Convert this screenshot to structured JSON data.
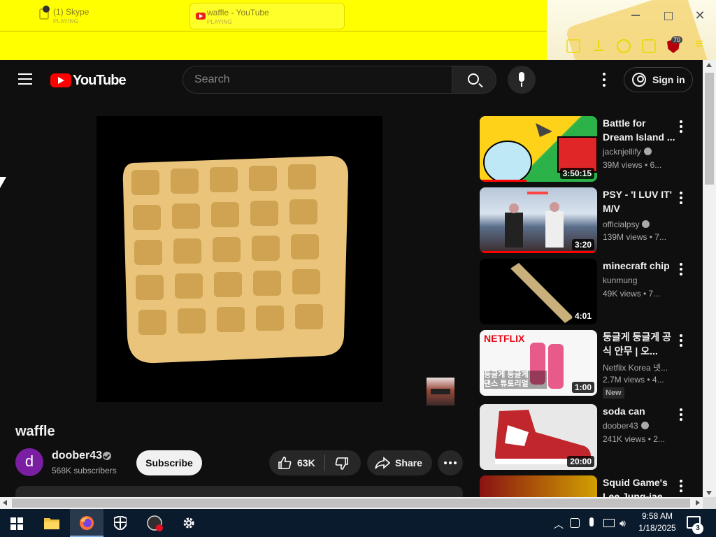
{
  "browser": {
    "tabs": [
      {
        "title": "(1) Skype",
        "status": "PLAYING"
      },
      {
        "title": "waffle - YouTube",
        "status": "PLAYING"
      }
    ],
    "extension_badge": "70",
    "accent": "#ffff00"
  },
  "header": {
    "logo": "YouTube",
    "search_placeholder": "Search",
    "signin_label": "Sign in",
    "brand_color": "#ff0000"
  },
  "video": {
    "title": "waffle",
    "channel": {
      "avatar_letter": "d",
      "name": "doober43",
      "subscribers": "568K subscribers"
    },
    "subscribe_label": "Subscribe",
    "like_count": "63K",
    "share_label": "Share"
  },
  "recommendations": [
    {
      "title": "Battle for Dream Island ...",
      "channel": "jacknjellify",
      "verified": true,
      "meta": "39M views • 6...",
      "duration": "3:50:15",
      "progress": 0.4
    },
    {
      "title": "PSY - 'I LUV IT' M/V",
      "channel": "officialpsy",
      "verified": true,
      "meta": "139M views • 7...",
      "duration": "3:20",
      "progress": 1.0
    },
    {
      "title": "minecraft chip",
      "channel": "kunmung",
      "verified": false,
      "meta": "49K views • 7...",
      "duration": "4:01",
      "progress": 0
    },
    {
      "title": "둥글게 둥글게 공식 안무 | 오...",
      "channel": "Netflix Korea 넷...",
      "verified": false,
      "meta": "2.7M views • 4...",
      "duration": "1:00",
      "badge": "New",
      "thumb_text": "NETFLIX",
      "thumb_caption": "둥글게 둥글게\n댄스 튜토리얼",
      "progress": 0
    },
    {
      "title": "soda can",
      "channel": "doober43",
      "verified": true,
      "meta": "241K views • 2...",
      "duration": "20:00",
      "progress": 0
    },
    {
      "title": "Squid Game's Lee Jung-jae...",
      "channel": "",
      "verified": false,
      "meta": "",
      "duration": "",
      "progress": 0
    }
  ],
  "taskbar": {
    "time": "9:58 AM",
    "date": "1/18/2025",
    "notification_count": "3"
  }
}
